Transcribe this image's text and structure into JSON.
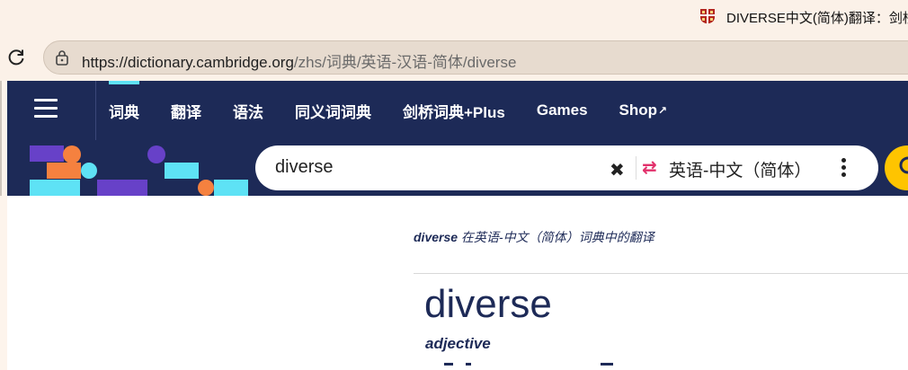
{
  "browser": {
    "tab_title": "DIVERSE中文(简体)翻译：剑桥词",
    "url_host": "https://dictionary.cambridge.org",
    "url_path": "/zhs/词典/英语-汉语-简体/diverse"
  },
  "nav": {
    "items": [
      {
        "label": "词典",
        "active": true
      },
      {
        "label": "翻译"
      },
      {
        "label": "语法"
      },
      {
        "label": "同义词词典"
      },
      {
        "label": "剑桥词典+Plus"
      },
      {
        "label": "Games"
      },
      {
        "label": "Shop",
        "external": true
      }
    ]
  },
  "search": {
    "value": "diverse",
    "language": "英语-中文（简体）"
  },
  "entry": {
    "header_word": "diverse",
    "header_rest": " 在英语-中文（简体）词典中的翻译",
    "headword": "diverse",
    "pos": "adjective"
  },
  "colors": {
    "nav_bg": "#1d2a57",
    "accent_cyan": "#5ee2f5",
    "accent_orange": "#f5813f",
    "accent_purple": "#6741c8",
    "search_button": "#fec400",
    "swap_icon": "#e2306b"
  }
}
